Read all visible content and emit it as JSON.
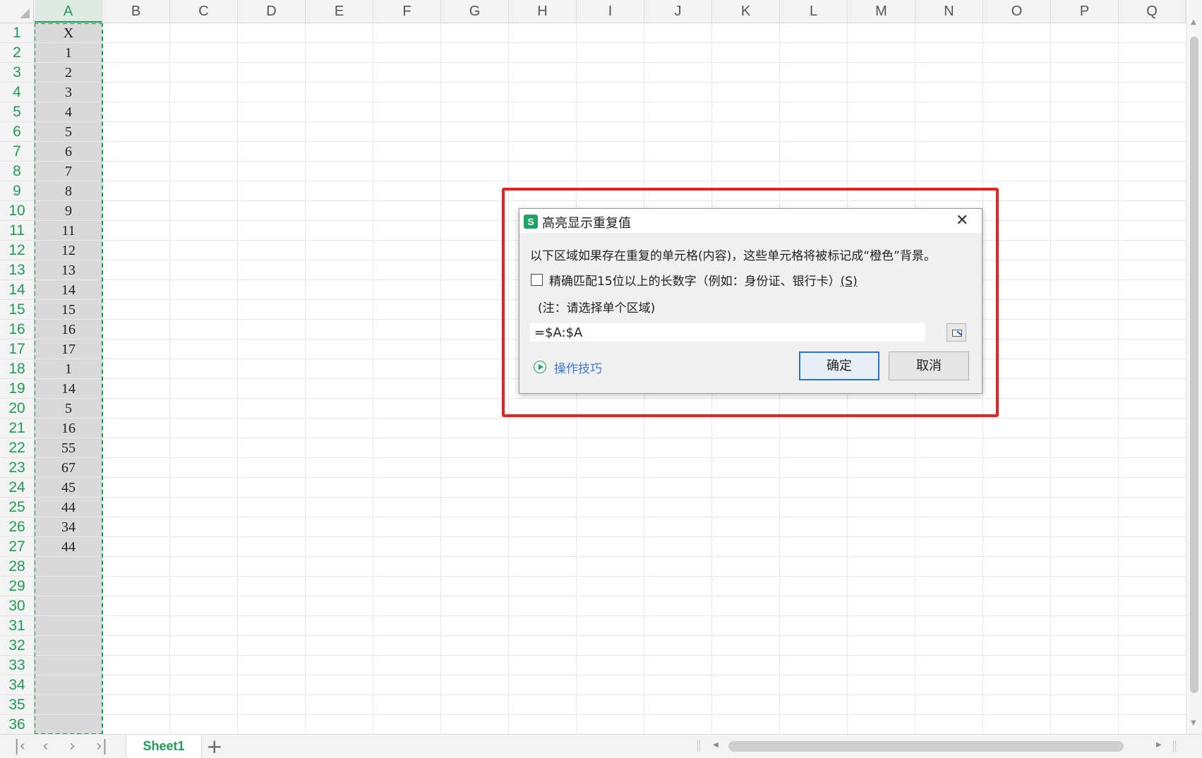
{
  "spreadsheet": {
    "columns": [
      "A",
      "B",
      "C",
      "D",
      "E",
      "F",
      "G",
      "H",
      "I",
      "J",
      "K",
      "L",
      "M",
      "N",
      "O",
      "P",
      "Q"
    ],
    "selected_column": "A",
    "rows": [
      "1",
      "2",
      "3",
      "4",
      "5",
      "6",
      "7",
      "8",
      "9",
      "10",
      "11",
      "12",
      "13",
      "14",
      "15",
      "16",
      "17",
      "18",
      "19",
      "20",
      "21",
      "22",
      "23",
      "24",
      "25",
      "26",
      "27",
      "28",
      "29",
      "30",
      "31",
      "32",
      "33",
      "34",
      "35",
      "36"
    ],
    "column_a_values": [
      "X",
      "1",
      "2",
      "3",
      "4",
      "5",
      "6",
      "7",
      "8",
      "9",
      "11",
      "12",
      "13",
      "14",
      "15",
      "16",
      "17",
      "1",
      "14",
      "5",
      "16",
      "55",
      "67",
      "45",
      "44",
      "34",
      "44"
    ]
  },
  "sheet_tabs": {
    "active": "Sheet1",
    "add_label": "+"
  },
  "dialog": {
    "title": "高亮显示重复值",
    "close_label": "✕",
    "message": "以下区域如果存在重复的单元格(内容)，这些单元格将被标记成“橙色”背景。",
    "checkbox_label": "精确匹配15位以上的长数字（例如：身份证、银行卡）",
    "checkbox_shortcut": "(S)",
    "checkbox_checked": false,
    "note": "(注：请选择单个区域)",
    "range_value": "=$A:$A",
    "tips_label": "操作技巧",
    "ok_label": "确定",
    "cancel_label": "取消"
  },
  "colors": {
    "accent": "#1f9a57",
    "highlight_frame": "#e8231f",
    "link": "#3b7bd4"
  }
}
